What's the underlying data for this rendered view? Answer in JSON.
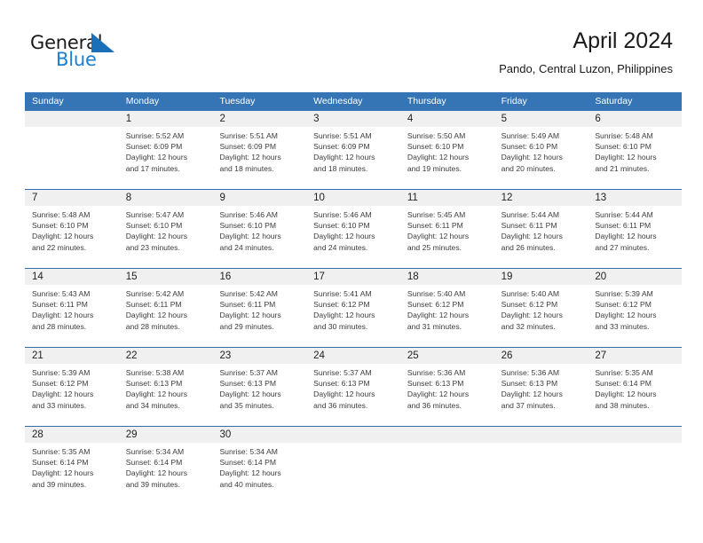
{
  "brand": {
    "name_part1": "General",
    "name_part2": "Blue",
    "triangle_icon": "triangle-icon",
    "color_dark": "#1a1a1a",
    "color_blue": "#1b7fd4"
  },
  "header": {
    "title": "April 2024",
    "subtitle": "Pando, Central Luzon, Philippines"
  },
  "theme": {
    "header_blue": "#3575b5",
    "row_divider_blue": "#2f6ea8",
    "daynum_band_gray": "#f0f0f0",
    "text_dark": "#222222",
    "text_body": "#3c3c3c"
  },
  "calendar": {
    "weekdays": [
      "Sunday",
      "Monday",
      "Tuesday",
      "Wednesday",
      "Thursday",
      "Friday",
      "Saturday"
    ],
    "weeks": [
      [
        {
          "day": "",
          "sunrise": "",
          "sunset": "",
          "daylight_line1": "",
          "daylight_line2": ""
        },
        {
          "day": "1",
          "sunrise": "Sunrise: 5:52 AM",
          "sunset": "Sunset: 6:09 PM",
          "daylight_line1": "Daylight: 12 hours",
          "daylight_line2": "and 17 minutes."
        },
        {
          "day": "2",
          "sunrise": "Sunrise: 5:51 AM",
          "sunset": "Sunset: 6:09 PM",
          "daylight_line1": "Daylight: 12 hours",
          "daylight_line2": "and 18 minutes."
        },
        {
          "day": "3",
          "sunrise": "Sunrise: 5:51 AM",
          "sunset": "Sunset: 6:09 PM",
          "daylight_line1": "Daylight: 12 hours",
          "daylight_line2": "and 18 minutes."
        },
        {
          "day": "4",
          "sunrise": "Sunrise: 5:50 AM",
          "sunset": "Sunset: 6:10 PM",
          "daylight_line1": "Daylight: 12 hours",
          "daylight_line2": "and 19 minutes."
        },
        {
          "day": "5",
          "sunrise": "Sunrise: 5:49 AM",
          "sunset": "Sunset: 6:10 PM",
          "daylight_line1": "Daylight: 12 hours",
          "daylight_line2": "and 20 minutes."
        },
        {
          "day": "6",
          "sunrise": "Sunrise: 5:48 AM",
          "sunset": "Sunset: 6:10 PM",
          "daylight_line1": "Daylight: 12 hours",
          "daylight_line2": "and 21 minutes."
        }
      ],
      [
        {
          "day": "7",
          "sunrise": "Sunrise: 5:48 AM",
          "sunset": "Sunset: 6:10 PM",
          "daylight_line1": "Daylight: 12 hours",
          "daylight_line2": "and 22 minutes."
        },
        {
          "day": "8",
          "sunrise": "Sunrise: 5:47 AM",
          "sunset": "Sunset: 6:10 PM",
          "daylight_line1": "Daylight: 12 hours",
          "daylight_line2": "and 23 minutes."
        },
        {
          "day": "9",
          "sunrise": "Sunrise: 5:46 AM",
          "sunset": "Sunset: 6:10 PM",
          "daylight_line1": "Daylight: 12 hours",
          "daylight_line2": "and 24 minutes."
        },
        {
          "day": "10",
          "sunrise": "Sunrise: 5:46 AM",
          "sunset": "Sunset: 6:10 PM",
          "daylight_line1": "Daylight: 12 hours",
          "daylight_line2": "and 24 minutes."
        },
        {
          "day": "11",
          "sunrise": "Sunrise: 5:45 AM",
          "sunset": "Sunset: 6:11 PM",
          "daylight_line1": "Daylight: 12 hours",
          "daylight_line2": "and 25 minutes."
        },
        {
          "day": "12",
          "sunrise": "Sunrise: 5:44 AM",
          "sunset": "Sunset: 6:11 PM",
          "daylight_line1": "Daylight: 12 hours",
          "daylight_line2": "and 26 minutes."
        },
        {
          "day": "13",
          "sunrise": "Sunrise: 5:44 AM",
          "sunset": "Sunset: 6:11 PM",
          "daylight_line1": "Daylight: 12 hours",
          "daylight_line2": "and 27 minutes."
        }
      ],
      [
        {
          "day": "14",
          "sunrise": "Sunrise: 5:43 AM",
          "sunset": "Sunset: 6:11 PM",
          "daylight_line1": "Daylight: 12 hours",
          "daylight_line2": "and 28 minutes."
        },
        {
          "day": "15",
          "sunrise": "Sunrise: 5:42 AM",
          "sunset": "Sunset: 6:11 PM",
          "daylight_line1": "Daylight: 12 hours",
          "daylight_line2": "and 28 minutes."
        },
        {
          "day": "16",
          "sunrise": "Sunrise: 5:42 AM",
          "sunset": "Sunset: 6:11 PM",
          "daylight_line1": "Daylight: 12 hours",
          "daylight_line2": "and 29 minutes."
        },
        {
          "day": "17",
          "sunrise": "Sunrise: 5:41 AM",
          "sunset": "Sunset: 6:12 PM",
          "daylight_line1": "Daylight: 12 hours",
          "daylight_line2": "and 30 minutes."
        },
        {
          "day": "18",
          "sunrise": "Sunrise: 5:40 AM",
          "sunset": "Sunset: 6:12 PM",
          "daylight_line1": "Daylight: 12 hours",
          "daylight_line2": "and 31 minutes."
        },
        {
          "day": "19",
          "sunrise": "Sunrise: 5:40 AM",
          "sunset": "Sunset: 6:12 PM",
          "daylight_line1": "Daylight: 12 hours",
          "daylight_line2": "and 32 minutes."
        },
        {
          "day": "20",
          "sunrise": "Sunrise: 5:39 AM",
          "sunset": "Sunset: 6:12 PM",
          "daylight_line1": "Daylight: 12 hours",
          "daylight_line2": "and 33 minutes."
        }
      ],
      [
        {
          "day": "21",
          "sunrise": "Sunrise: 5:39 AM",
          "sunset": "Sunset: 6:12 PM",
          "daylight_line1": "Daylight: 12 hours",
          "daylight_line2": "and 33 minutes."
        },
        {
          "day": "22",
          "sunrise": "Sunrise: 5:38 AM",
          "sunset": "Sunset: 6:13 PM",
          "daylight_line1": "Daylight: 12 hours",
          "daylight_line2": "and 34 minutes."
        },
        {
          "day": "23",
          "sunrise": "Sunrise: 5:37 AM",
          "sunset": "Sunset: 6:13 PM",
          "daylight_line1": "Daylight: 12 hours",
          "daylight_line2": "and 35 minutes."
        },
        {
          "day": "24",
          "sunrise": "Sunrise: 5:37 AM",
          "sunset": "Sunset: 6:13 PM",
          "daylight_line1": "Daylight: 12 hours",
          "daylight_line2": "and 36 minutes."
        },
        {
          "day": "25",
          "sunrise": "Sunrise: 5:36 AM",
          "sunset": "Sunset: 6:13 PM",
          "daylight_line1": "Daylight: 12 hours",
          "daylight_line2": "and 36 minutes."
        },
        {
          "day": "26",
          "sunrise": "Sunrise: 5:36 AM",
          "sunset": "Sunset: 6:13 PM",
          "daylight_line1": "Daylight: 12 hours",
          "daylight_line2": "and 37 minutes."
        },
        {
          "day": "27",
          "sunrise": "Sunrise: 5:35 AM",
          "sunset": "Sunset: 6:14 PM",
          "daylight_line1": "Daylight: 12 hours",
          "daylight_line2": "and 38 minutes."
        }
      ],
      [
        {
          "day": "28",
          "sunrise": "Sunrise: 5:35 AM",
          "sunset": "Sunset: 6:14 PM",
          "daylight_line1": "Daylight: 12 hours",
          "daylight_line2": "and 39 minutes."
        },
        {
          "day": "29",
          "sunrise": "Sunrise: 5:34 AM",
          "sunset": "Sunset: 6:14 PM",
          "daylight_line1": "Daylight: 12 hours",
          "daylight_line2": "and 39 minutes."
        },
        {
          "day": "30",
          "sunrise": "Sunrise: 5:34 AM",
          "sunset": "Sunset: 6:14 PM",
          "daylight_line1": "Daylight: 12 hours",
          "daylight_line2": "and 40 minutes."
        },
        {
          "day": "",
          "sunrise": "",
          "sunset": "",
          "daylight_line1": "",
          "daylight_line2": ""
        },
        {
          "day": "",
          "sunrise": "",
          "sunset": "",
          "daylight_line1": "",
          "daylight_line2": ""
        },
        {
          "day": "",
          "sunrise": "",
          "sunset": "",
          "daylight_line1": "",
          "daylight_line2": ""
        },
        {
          "day": "",
          "sunrise": "",
          "sunset": "",
          "daylight_line1": "",
          "daylight_line2": ""
        }
      ]
    ]
  }
}
